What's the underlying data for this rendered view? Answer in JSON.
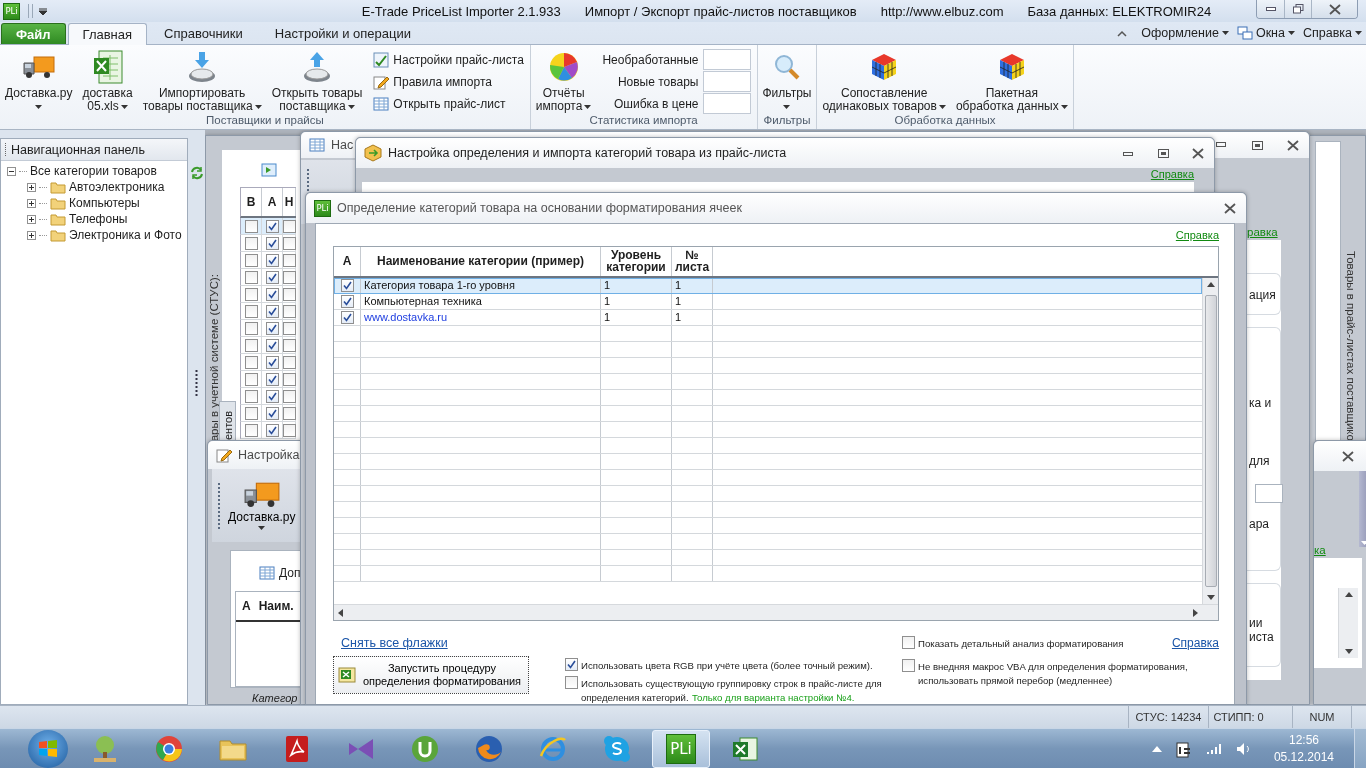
{
  "title_bar": {
    "app_logo": "PLi",
    "segments": [
      "E-Trade PriceList Importer 2.1.933",
      "Импорт / Экспорт прайс-листов поставщиков",
      "http://www.elbuz.com",
      "База данных: ELEKTROMIR24"
    ]
  },
  "ribbon_tabs": [
    {
      "label": "Файл",
      "kind": "file",
      "selected": false
    },
    {
      "label": "Главная",
      "kind": "tab",
      "selected": true
    },
    {
      "label": "Справочники",
      "kind": "tab",
      "selected": false
    },
    {
      "label": "Настройки и операции",
      "kind": "tab",
      "selected": false
    }
  ],
  "ribbon_menus": [
    {
      "label": "Оформление"
    },
    {
      "label": "Окна"
    },
    {
      "label": "Справка"
    }
  ],
  "ribbon_groups": [
    {
      "label": "Поставщики и прайсы",
      "buttons": [
        {
          "lines": [
            "Доставка.ру"
          ]
        },
        {
          "lines": [
            "доставка",
            "05.xls"
          ]
        },
        {
          "lines": [
            "Импортировать",
            "товары поставщика"
          ]
        },
        {
          "lines": [
            "Открыть товары",
            "поставщика"
          ]
        }
      ],
      "column": [
        {
          "kind": "small",
          "label": "Настройки прайс-листа"
        },
        {
          "kind": "small",
          "label": "Правила импорта"
        },
        {
          "kind": "small",
          "label": "Открыть прайс-лист"
        }
      ]
    },
    {
      "label": "Статистика импорта",
      "buttons": [
        {
          "lines": [
            "Отчёты",
            "импорта"
          ]
        }
      ],
      "column": [
        {
          "kind": "stat",
          "label": "Необработанные"
        },
        {
          "kind": "stat",
          "label": "Новые товары"
        },
        {
          "kind": "stat",
          "label": "Ошибка в цене"
        }
      ]
    },
    {
      "label": "Фильтры",
      "buttons": [
        {
          "lines": [
            "Фильтры"
          ]
        }
      ]
    },
    {
      "label": "Обработка данных",
      "buttons": [
        {
          "lines": [
            "Сопоставление",
            "одинаковых товаров"
          ]
        },
        {
          "lines": [
            "Пакетная",
            "обработка данных"
          ]
        }
      ]
    }
  ],
  "nav_panel": {
    "title": "Навигационная панель",
    "tree": [
      {
        "label": "Все категории товаров",
        "expanded": true,
        "children": [
          {
            "label": "Автоэлектроника",
            "expanded": false
          },
          {
            "label": "Компьютеры",
            "expanded": false
          },
          {
            "label": "Телефоны",
            "expanded": false
          },
          {
            "label": "Электроника и Фото",
            "expanded": false
          }
        ]
      }
    ]
  },
  "background_windows": {
    "stus_pane": {
      "caption": "ары в учетной системе (СТУС):",
      "tab": "ентов",
      "columns": [
        "В",
        "А",
        "Н"
      ],
      "rows": [
        {
          "selected": true,
          "cells": [
            {
              "checked": false
            },
            {
              "checked": true
            },
            {
              "checked": false
            }
          ]
        },
        {
          "selected": false,
          "cells": [
            {
              "checked": false
            },
            {
              "checked": true
            },
            {
              "checked": false
            }
          ]
        },
        {
          "selected": false,
          "cells": [
            {
              "checked": false
            },
            {
              "checked": true
            },
            {
              "checked": false
            }
          ]
        },
        {
          "selected": false,
          "cells": [
            {
              "checked": false
            },
            {
              "checked": true
            },
            {
              "checked": false
            }
          ]
        },
        {
          "selected": false,
          "cells": [
            {
              "checked": false
            },
            {
              "checked": true
            },
            {
              "checked": false
            }
          ]
        },
        {
          "selected": false,
          "cells": [
            {
              "checked": false
            },
            {
              "checked": true
            },
            {
              "checked": false
            }
          ]
        },
        {
          "selected": false,
          "cells": [
            {
              "checked": false
            },
            {
              "checked": true
            },
            {
              "checked": false
            }
          ]
        },
        {
          "selected": false,
          "cells": [
            {
              "checked": false
            },
            {
              "checked": true
            },
            {
              "checked": false
            }
          ]
        },
        {
          "selected": false,
          "cells": [
            {
              "checked": false
            },
            {
              "checked": true
            },
            {
              "checked": false
            }
          ]
        },
        {
          "selected": false,
          "cells": [
            {
              "checked": false
            },
            {
              "checked": true
            },
            {
              "checked": false
            }
          ]
        },
        {
          "selected": false,
          "cells": [
            {
              "checked": false
            },
            {
              "checked": true
            },
            {
              "checked": false
            }
          ]
        },
        {
          "selected": false,
          "cells": [
            {
              "checked": false
            },
            {
              "checked": true
            },
            {
              "checked": false
            }
          ]
        },
        {
          "selected": false,
          "cells": [
            {
              "checked": false
            },
            {
              "checked": true
            },
            {
              "checked": false
            }
          ]
        }
      ]
    },
    "prices_pane": {
      "caption": "Товары в прайс-листах поставщико"
    },
    "supplier_window": {
      "title": "Нас",
      "help_link": "равка",
      "fragments": [
        "ация",
        "ка и",
        "для",
        "ара",
        "ии",
        "иста"
      ]
    },
    "category_window": {
      "title": "Настройка определения и импорта категорий товара из прайс-листа",
      "help_link": "Справка"
    },
    "settings_window": {
      "title": "Настройка",
      "toolbar_button": "Доставка.ру",
      "tab": "Доп",
      "columns": [
        "А",
        "Наим."
      ],
      "footer": "Категор"
    },
    "small_window": {
      "help_link": "ка"
    }
  },
  "dialog": {
    "logo": "PLi",
    "title": "Определение категорий товара на основании форматирования ячеек",
    "help_link": "Справка",
    "columns": [
      "А",
      "Наименование категории (пример)",
      "Уровень категории",
      "№ листа"
    ],
    "rows": [
      {
        "selected": true,
        "checked": true,
        "kind": "text",
        "name": "Категория товара 1-го уровня",
        "level": "1",
        "sheet": "1"
      },
      {
        "selected": false,
        "checked": true,
        "kind": "text",
        "name": "Компьютерная техника",
        "level": "1",
        "sheet": "1"
      },
      {
        "selected": false,
        "checked": true,
        "kind": "link",
        "name": "www.dostavka.ru",
        "level": "1",
        "sheet": "1"
      }
    ],
    "clear_link": "Снять все флажки",
    "run_button": "Запустить процедуру определения форматирования",
    "options": [
      {
        "checked": true,
        "label": "Использовать цвета RGB при учёте цвета (более точный режим)."
      },
      {
        "checked": false,
        "label": "Использовать существующую группировку строк в прайс-листе для определения категорий.",
        "note": "Только для варианта настройки №4."
      },
      {
        "checked": false,
        "label": "Показать детальный анализ форматирования"
      },
      {
        "checked": false,
        "label": "Не внедняя макрос VBA для определения форматирования, использовать прямой перебор (медленнее)"
      }
    ],
    "footer_help_link": "Справка"
  },
  "status_bar": [
    "СТУС: 14234",
    "СТИПП: 0",
    "NUM"
  ],
  "taskbar": {
    "apps": [
      {
        "selected": false
      },
      {
        "selected": false
      },
      {
        "selected": false
      },
      {
        "selected": false
      },
      {
        "selected": false
      },
      {
        "selected": false
      },
      {
        "selected": false
      },
      {
        "selected": false
      },
      {
        "selected": false
      },
      {
        "selected": true
      },
      {
        "selected": false
      }
    ],
    "pli_logo": "PLi",
    "clock_time": "12:56",
    "clock_date": "05.12.2014"
  }
}
